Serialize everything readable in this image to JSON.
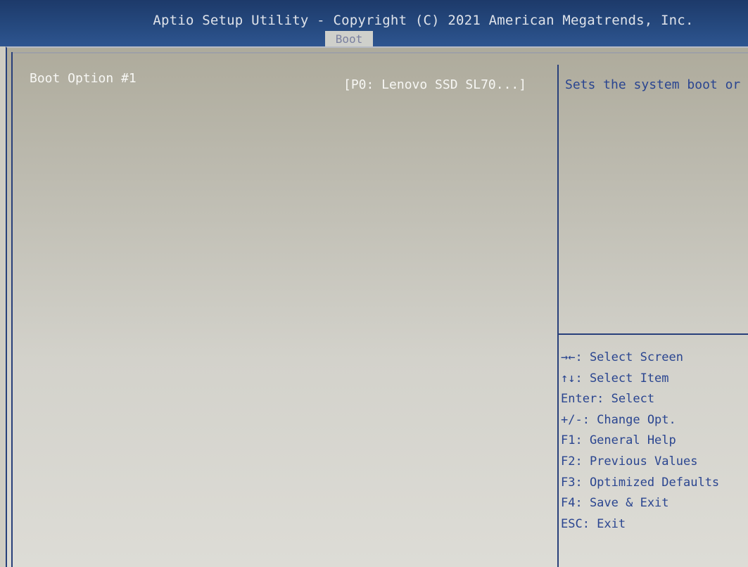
{
  "header": {
    "title": "Aptio Setup Utility - Copyright (C) 2021 American Megatrends, Inc.",
    "active_tab": "Boot"
  },
  "main": {
    "option_label": "Boot Option #1",
    "option_value": "[P0: Lenovo SSD SL70...]"
  },
  "help": {
    "text": "Sets the system boot or"
  },
  "keys": [
    "→←: Select Screen",
    "↑↓: Select Item",
    "Enter: Select",
    "+/-: Change Opt.",
    "F1: General Help",
    "F2: Previous Values",
    "F3: Optimized Defaults",
    "F4: Save & Exit",
    "ESC: Exit"
  ],
  "colors": {
    "header_bg": "#264a80",
    "panel_bg": "#cfcdc3",
    "help_text": "#2a4590",
    "option_text": "#f7f7f4"
  }
}
